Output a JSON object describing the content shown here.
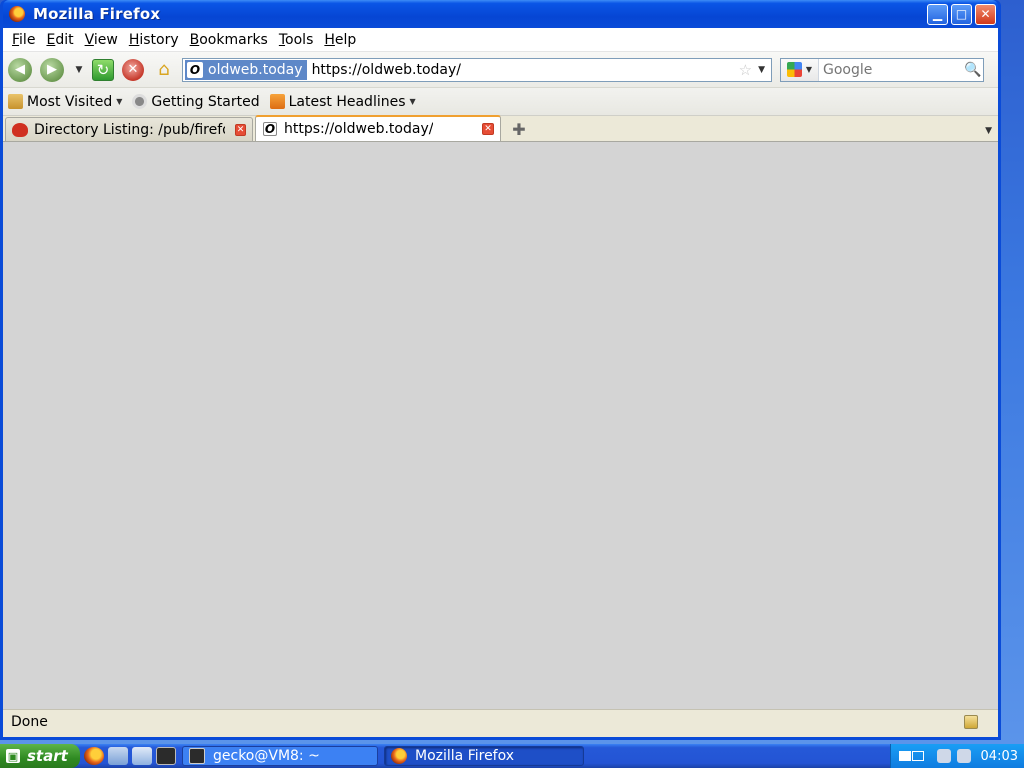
{
  "window": {
    "title": "Mozilla Firefox"
  },
  "menu": {
    "items": [
      {
        "label": "File",
        "key": "F",
        "rest": "ile"
      },
      {
        "label": "Edit",
        "key": "E",
        "rest": "dit"
      },
      {
        "label": "View",
        "key": "V",
        "rest": "iew"
      },
      {
        "label": "History",
        "key": "H",
        "rest": "istory"
      },
      {
        "label": "Bookmarks",
        "key": "B",
        "rest": "ookmarks"
      },
      {
        "label": "Tools",
        "key": "T",
        "rest": "ools"
      },
      {
        "label": "Help",
        "key": "H",
        "rest": "elp"
      }
    ]
  },
  "nav": {
    "identity_label": "oldweb.today",
    "url": "https://oldweb.today/",
    "search_placeholder": "Google"
  },
  "bookmarks": {
    "most_visited": "Most Visited",
    "getting_started": "Getting Started",
    "latest_headlines": "Latest Headlines"
  },
  "tabs": [
    {
      "label": "Directory Listing: /pub/firefo…",
      "active": false
    },
    {
      "label": "https://oldweb.today/",
      "active": true
    }
  ],
  "status": {
    "text": "Done"
  },
  "taskbar": {
    "start_label": "start",
    "tasks": [
      {
        "label": "gecko@VM8: ~"
      },
      {
        "label": "Mozilla Firefox"
      }
    ],
    "clock": "04:03"
  }
}
